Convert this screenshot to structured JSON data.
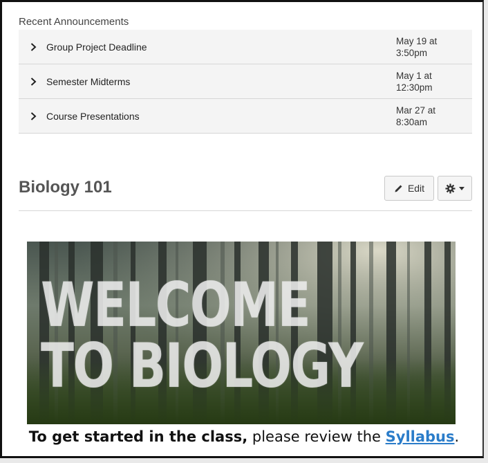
{
  "announcements": {
    "heading": "Recent Announcements",
    "items": [
      {
        "title": "Group Project Deadline",
        "date_line1": "May 19 at",
        "date_line2": "3:50pm"
      },
      {
        "title": "Semester Midterms",
        "date_line1": "May 1 at",
        "date_line2": "12:30pm"
      },
      {
        "title": "Course Presentations",
        "date_line1": "Mar 27 at",
        "date_line2": "8:30am"
      }
    ]
  },
  "course": {
    "title": "Biology 101",
    "edit_label": "Edit"
  },
  "banner": {
    "line1": "WELCOME",
    "line2": "TO BIOLOGY"
  },
  "cta": {
    "bold_part": "To get started in the class,",
    "normal_part": " please review the ",
    "link_text": "Syllabus",
    "end": "."
  },
  "icons": {
    "chevron": "chevron-right-icon",
    "edit": "pencil-icon",
    "settings": "gear-icon",
    "dropdown": "caret-down-icon"
  },
  "colors": {
    "link": "#2a7cc9",
    "row_bg": "#f4f4f4"
  }
}
